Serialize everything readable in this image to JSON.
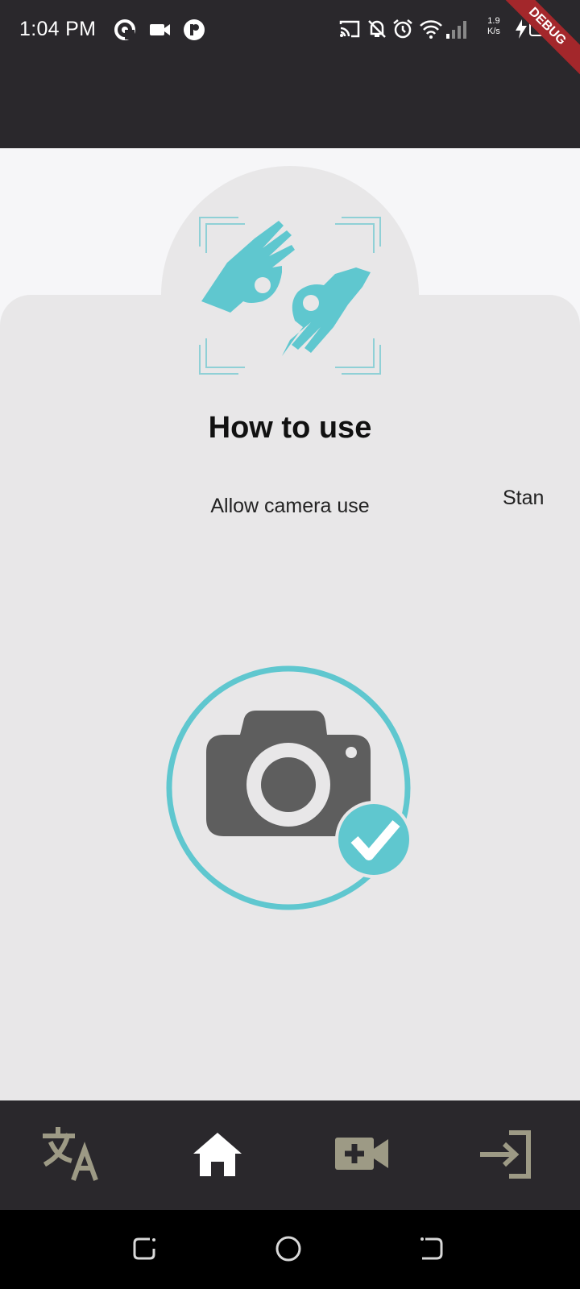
{
  "status_bar": {
    "time": "1:04 PM",
    "net_speed_value": "1.9",
    "net_speed_unit": "K/s",
    "debug_label": "DEBUG"
  },
  "onboarding": {
    "title": "How to use",
    "current_step": "Allow camera use",
    "next_step_peek": "Stan"
  },
  "bottom_nav": {
    "items": [
      {
        "icon": "translate-icon",
        "active": false
      },
      {
        "icon": "home-icon",
        "active": true
      },
      {
        "icon": "video-add-icon",
        "active": false
      },
      {
        "icon": "login-icon",
        "active": false
      }
    ]
  },
  "colors": {
    "accent": "#5fc7cf",
    "bar_bg": "#2a282c",
    "inactive_nav": "#9d9a85",
    "panel_bg": "#e8e7e8",
    "camera_gray": "#5e5e5e"
  }
}
